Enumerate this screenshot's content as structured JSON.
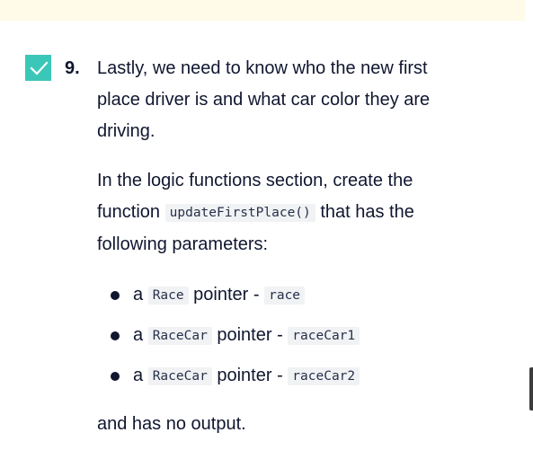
{
  "step": {
    "number": "9.",
    "completed": true,
    "intro": "Lastly, we need to know who the new first place driver is and what car color they are driving.",
    "instruction_prefix": "In the logic functions section, create the function",
    "function_name": "updateFirstPlace()",
    "instruction_suffix": "that has the following parameters:",
    "parameters": [
      {
        "article": "a",
        "type": "Race",
        "word": "pointer -",
        "name": "race"
      },
      {
        "article": "a",
        "type": "RaceCar",
        "word": "pointer -",
        "name": "raceCar1"
      },
      {
        "article": "a",
        "type": "RaceCar",
        "word": "pointer -",
        "name": "raceCar2"
      }
    ],
    "outro": "and has no output."
  },
  "colors": {
    "checkbox": "#3bc7b8",
    "banner": "#fffbe8",
    "text": "#10162f",
    "code_bg": "#f1f2f4"
  },
  "icons": {
    "checkbox": "checkmark-icon"
  }
}
